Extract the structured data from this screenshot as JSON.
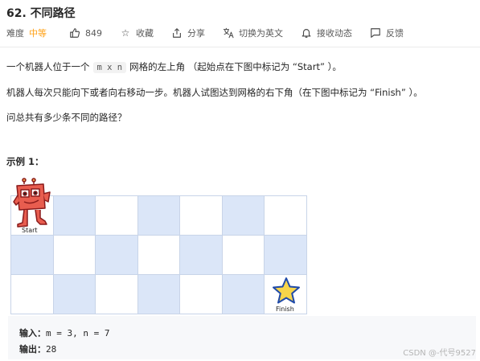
{
  "problem": {
    "title": "62. 不同路径",
    "difficulty_label": "难度",
    "difficulty_value": "中等",
    "likes": "849",
    "favorite": "收藏",
    "share": "分享",
    "switch_lang": "切换为英文",
    "notify": "接收动态",
    "feedback": "反馈"
  },
  "description": {
    "p1_a": "一个机器人位于一个",
    "p1_code": "m x n",
    "p1_b": "网格的左上角 （起始点在下图中标记为 “Start” ）。",
    "p2": "机器人每次只能向下或者向右移动一步。机器人试图达到网格的右下角（在下图中标记为 “Finish” ）。",
    "p3": "问总共有多少条不同的路径？"
  },
  "example": {
    "title": "示例 1：",
    "start_label": "Start",
    "finish_label": "Finish",
    "input_key": "输入：",
    "input_value": "m = 3, n = 7",
    "output_key": "输出：",
    "output_value": "28"
  },
  "grid": {
    "rows": 3,
    "cols": 7,
    "blue_cells": [
      [
        0,
        1
      ],
      [
        0,
        3
      ],
      [
        0,
        5
      ],
      [
        1,
        0
      ],
      [
        1,
        2
      ],
      [
        1,
        4
      ],
      [
        1,
        6
      ],
      [
        2,
        1
      ],
      [
        2,
        3
      ],
      [
        2,
        5
      ]
    ]
  },
  "watermark": "CSDN @-代号9527",
  "colors": {
    "accent": "#ffa116",
    "grid_blue": "#dbe6f8"
  }
}
